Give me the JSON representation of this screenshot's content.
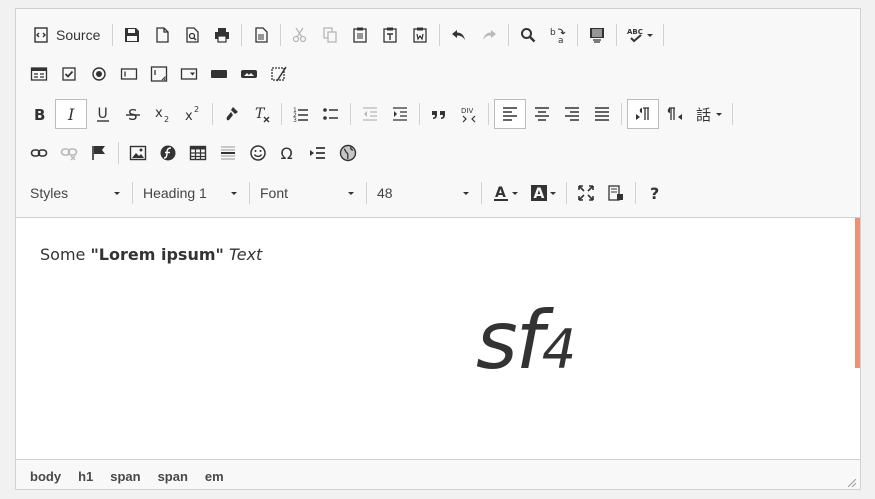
{
  "toolbar": {
    "source_label": "Source",
    "styles_label": "Styles",
    "format_label": "Heading 1",
    "font_label": "Font",
    "size_label": "48"
  },
  "content": {
    "p_before": "Some ",
    "p_bold": "\"Lorem ipsum\"",
    "p_space": " ",
    "p_italic": "Text",
    "h1_main": "sf",
    "h1_sub": "4"
  },
  "statusbar": {
    "path": [
      "body",
      "h1",
      "span",
      "span",
      "em"
    ]
  },
  "colors": {
    "accent_scroll": "#ef9175",
    "toolbar_bg": "#f8f8f8",
    "border": "#d1d1d1"
  }
}
